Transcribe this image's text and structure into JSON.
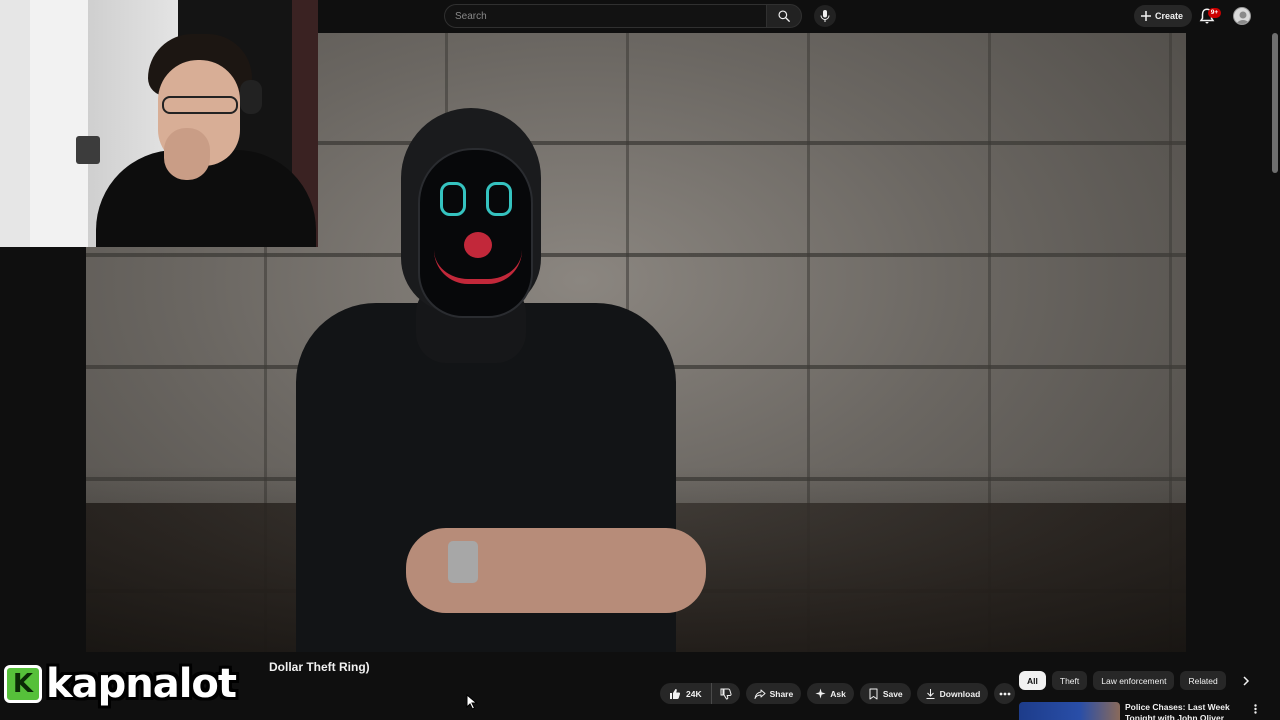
{
  "search": {
    "placeholder": "Search"
  },
  "header": {
    "create_label": "Create",
    "notification_count": "9+"
  },
  "video": {
    "title": "Dollar Theft Ring)"
  },
  "channel": {
    "logo_letter": "K",
    "name": "kapnalot"
  },
  "actions": {
    "like_count": "24K",
    "share_label": "Share",
    "ask_label": "Ask",
    "save_label": "Save",
    "download_label": "Download"
  },
  "chips": [
    "All",
    "Theft",
    "Law enforcement",
    "Related"
  ],
  "recommended": [
    {
      "title": "Police Chases: Last Week Tonight with John Oliver (HBO)"
    }
  ],
  "icons": {
    "search": "search-icon",
    "mic": "microphone-icon",
    "create": "plus-icon",
    "notifications": "bell-icon",
    "like": "thumbs-up-icon",
    "dislike": "thumbs-down-icon",
    "share": "share-icon",
    "ask": "sparkle-icon",
    "save": "bookmark-icon",
    "download": "download-icon",
    "more": "more-horizontal-icon",
    "chips_next": "chevron-right-icon"
  },
  "colors": {
    "background": "#0f0f0f",
    "pill": "#272727",
    "badge": "#cc0000",
    "logo_green": "#56c03a"
  }
}
